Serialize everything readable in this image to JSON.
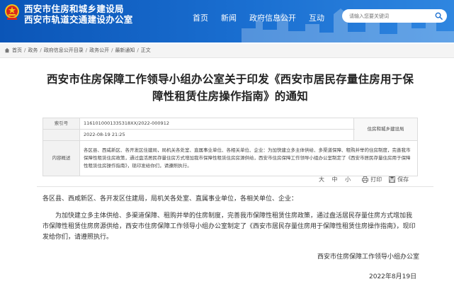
{
  "header": {
    "site_name_line1": "西安市住房和城乡建设局",
    "site_name_line2": "西安市轨道交通建设办公室",
    "nav": [
      "首页",
      "新闻",
      "政府信息公开",
      "互动"
    ],
    "search_placeholder": "请输入您要关键词"
  },
  "breadcrumb": [
    "首页",
    "政务",
    "政府信息公开目录",
    "政务公开",
    "最新通知",
    "正文"
  ],
  "article": {
    "title": "西安市住房保障工作领导小组办公室关于印发《西安市居民存量住房用于保障性租赁住房操作指南》的通知",
    "info": {
      "index_label": "索引号",
      "index_value": "11610100013353​18XX/2022-000912",
      "dispatch_unit": "住房和城乡建设局",
      "date_value": "2022-08-19 21:25",
      "summary_label": "内容概述",
      "summary_text": "各区县、西咸新区、各开发区住建局，局机关各处室、直属事业单位、各相关单位、企业：为加快建立多主体供给、多渠道保障、租购并举的住房制度，完善我市保障性租赁住房政策，通过盘活居民存量住房方式增加我市保障性租赁住房房源供给，西安市住房保障工作领导小组办公室制定了《西安市居民存量住房用于保障性租赁住房操作指南》，现印发给你们，请遵照执行。"
    },
    "tools": {
      "font_size": "大 中 小",
      "print": "打印",
      "save": "保存"
    },
    "recipients": "各区县、西咸新区、各开发区住建局，局机关各处室、直属事业单位，各相关单位、企业：",
    "body": "为加快建立多主体供给、多渠道保障、租购并举的住房制度，完善我市保障性租赁住房政策，通过盘活居民存量住房方式增加我市保障性租赁住房房源供给，西安市住房保障工作领导小组办公室制定了《西安市居民存量住房用于保障性租赁住房操作指南》，现印发给你们，请遵照执行。",
    "signature": "西安市住房保障工作领导小组办公室",
    "date": "2022年8月19日"
  },
  "colors": {
    "header_blue": "#0b55b7",
    "header_light": "#2f86e0",
    "emblem_red": "#d7261e",
    "emblem_gold": "#f5c518"
  },
  "icons": [
    "emblem-icon",
    "search-icon",
    "home-icon",
    "print-icon",
    "save-icon"
  ]
}
